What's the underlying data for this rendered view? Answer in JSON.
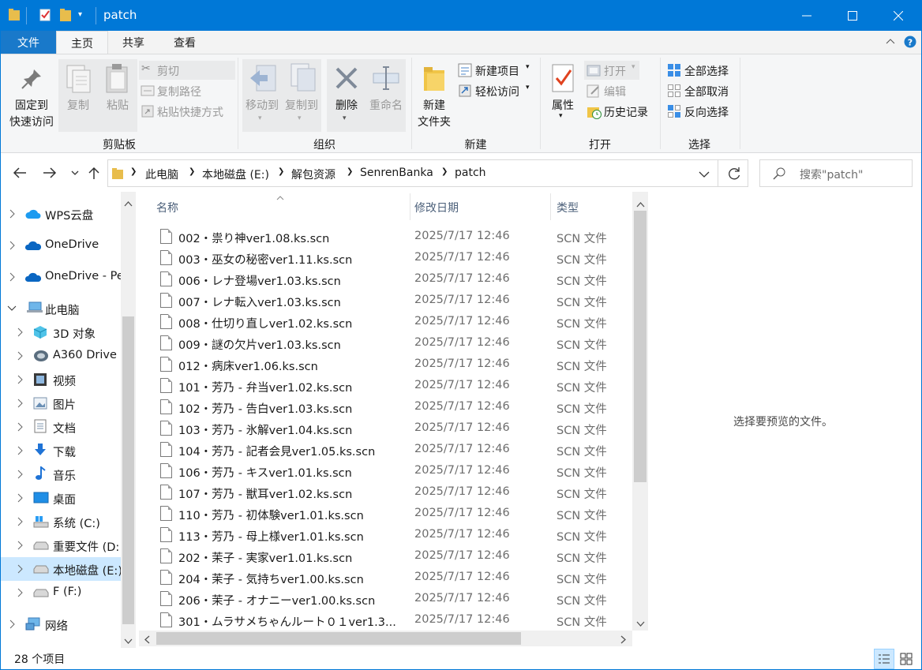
{
  "window": {
    "title": "patch"
  },
  "tabs": [
    "文件",
    "主页",
    "共享",
    "查看"
  ],
  "ribbon": {
    "pin": [
      "固定到",
      "快速访问"
    ],
    "copy": "复制",
    "paste": "粘贴",
    "cut": "剪切",
    "copy_path": "复制路径",
    "paste_shortcut": "粘贴快捷方式",
    "move_to": "移动到",
    "copy_to": "复制到",
    "delete": "删除",
    "rename": "重命名",
    "new_folder": [
      "新建",
      "文件夹"
    ],
    "new_item": "新建项目",
    "easy_access": "轻松访问",
    "properties": "属性",
    "open": "打开",
    "edit": "编辑",
    "history": "历史记录",
    "select_all": "全部选择",
    "select_none": "全部取消",
    "invert_selection": "反向选择",
    "groups": {
      "clipboard": "剪贴板",
      "organize": "组织",
      "new": "新建",
      "open": "打开",
      "select": "选择"
    }
  },
  "address": {
    "crumbs": [
      "此电脑",
      "本地磁盘 (E:)",
      "解包资源",
      "SenrenBanka",
      "patch"
    ],
    "search_placeholder": "搜索\"patch\""
  },
  "nav_tree": [
    {
      "label": "WPS云盘",
      "icon": "wps-cloud-icon"
    },
    {
      "label": "OneDrive",
      "icon": "onedrive-icon"
    },
    {
      "label": "OneDrive - Pe",
      "icon": "onedrive-icon"
    },
    {
      "label": "此电脑",
      "icon": "this-pc-icon",
      "expanded": true
    },
    {
      "label": "3D 对象",
      "icon": "3d-objects-icon"
    },
    {
      "label": "A360 Drive",
      "icon": "a360-drive-icon"
    },
    {
      "label": "视频",
      "icon": "video-icon"
    },
    {
      "label": "图片",
      "icon": "pictures-icon"
    },
    {
      "label": "文档",
      "icon": "documents-icon"
    },
    {
      "label": "下载",
      "icon": "download-icon"
    },
    {
      "label": "音乐",
      "icon": "music-icon"
    },
    {
      "label": "桌面",
      "icon": "desktop-icon"
    },
    {
      "label": "系统 (C:)",
      "icon": "system-drive-icon"
    },
    {
      "label": "重要文件 (D:",
      "icon": "drive-icon"
    },
    {
      "label": "本地磁盘 (E:)",
      "icon": "drive-icon",
      "selected": true
    },
    {
      "label": "F (F:)",
      "icon": "drive-icon"
    },
    {
      "label": "网络",
      "icon": "network-icon"
    }
  ],
  "columns": {
    "name": "名称",
    "date": "修改日期",
    "type": "类型"
  },
  "files": [
    {
      "name": "002・祟り神ver1.08.ks.scn",
      "date": "2025/7/17 12:46",
      "type": "SCN 文件"
    },
    {
      "name": "003・巫女の秘密ver1.11.ks.scn",
      "date": "2025/7/17 12:46",
      "type": "SCN 文件"
    },
    {
      "name": "006・レナ登場ver1.03.ks.scn",
      "date": "2025/7/17 12:46",
      "type": "SCN 文件"
    },
    {
      "name": "007・レナ転入ver1.03.ks.scn",
      "date": "2025/7/17 12:46",
      "type": "SCN 文件"
    },
    {
      "name": "008・仕切り直しver1.02.ks.scn",
      "date": "2025/7/17 12:46",
      "type": "SCN 文件"
    },
    {
      "name": "009・謎の欠片ver1.03.ks.scn",
      "date": "2025/7/17 12:46",
      "type": "SCN 文件"
    },
    {
      "name": "012・病床ver1.06.ks.scn",
      "date": "2025/7/17 12:46",
      "type": "SCN 文件"
    },
    {
      "name": "101・芳乃 - 弁当ver1.02.ks.scn",
      "date": "2025/7/17 12:46",
      "type": "SCN 文件"
    },
    {
      "name": "102・芳乃 - 告白ver1.03.ks.scn",
      "date": "2025/7/17 12:46",
      "type": "SCN 文件"
    },
    {
      "name": "103・芳乃 - 氷解ver1.04.ks.scn",
      "date": "2025/7/17 12:46",
      "type": "SCN 文件"
    },
    {
      "name": "104・芳乃 - 記者会見ver1.05.ks.scn",
      "date": "2025/7/17 12:46",
      "type": "SCN 文件"
    },
    {
      "name": "106・芳乃 - キスver1.01.ks.scn",
      "date": "2025/7/17 12:46",
      "type": "SCN 文件"
    },
    {
      "name": "107・芳乃 - 獣耳ver1.02.ks.scn",
      "date": "2025/7/17 12:46",
      "type": "SCN 文件"
    },
    {
      "name": "110・芳乃 - 初体験ver1.01.ks.scn",
      "date": "2025/7/17 12:46",
      "type": "SCN 文件"
    },
    {
      "name": "113・芳乃 - 母上様ver1.01.ks.scn",
      "date": "2025/7/17 12:46",
      "type": "SCN 文件"
    },
    {
      "name": "202・茉子 - 実家ver1.01.ks.scn",
      "date": "2025/7/17 12:46",
      "type": "SCN 文件"
    },
    {
      "name": "204・茉子 - 気持ちver1.00.ks.scn",
      "date": "2025/7/17 12:46",
      "type": "SCN 文件"
    },
    {
      "name": "206・茉子 - オナニーver1.00.ks.scn",
      "date": "2025/7/17 12:46",
      "type": "SCN 文件"
    },
    {
      "name": "301・ムラサメちゃんルート０１ver1.3...",
      "date": "2025/7/17 12:46",
      "type": "SCN 文件"
    }
  ],
  "preview_text": "选择要预览的文件。",
  "status": {
    "count": "28 个项目"
  }
}
